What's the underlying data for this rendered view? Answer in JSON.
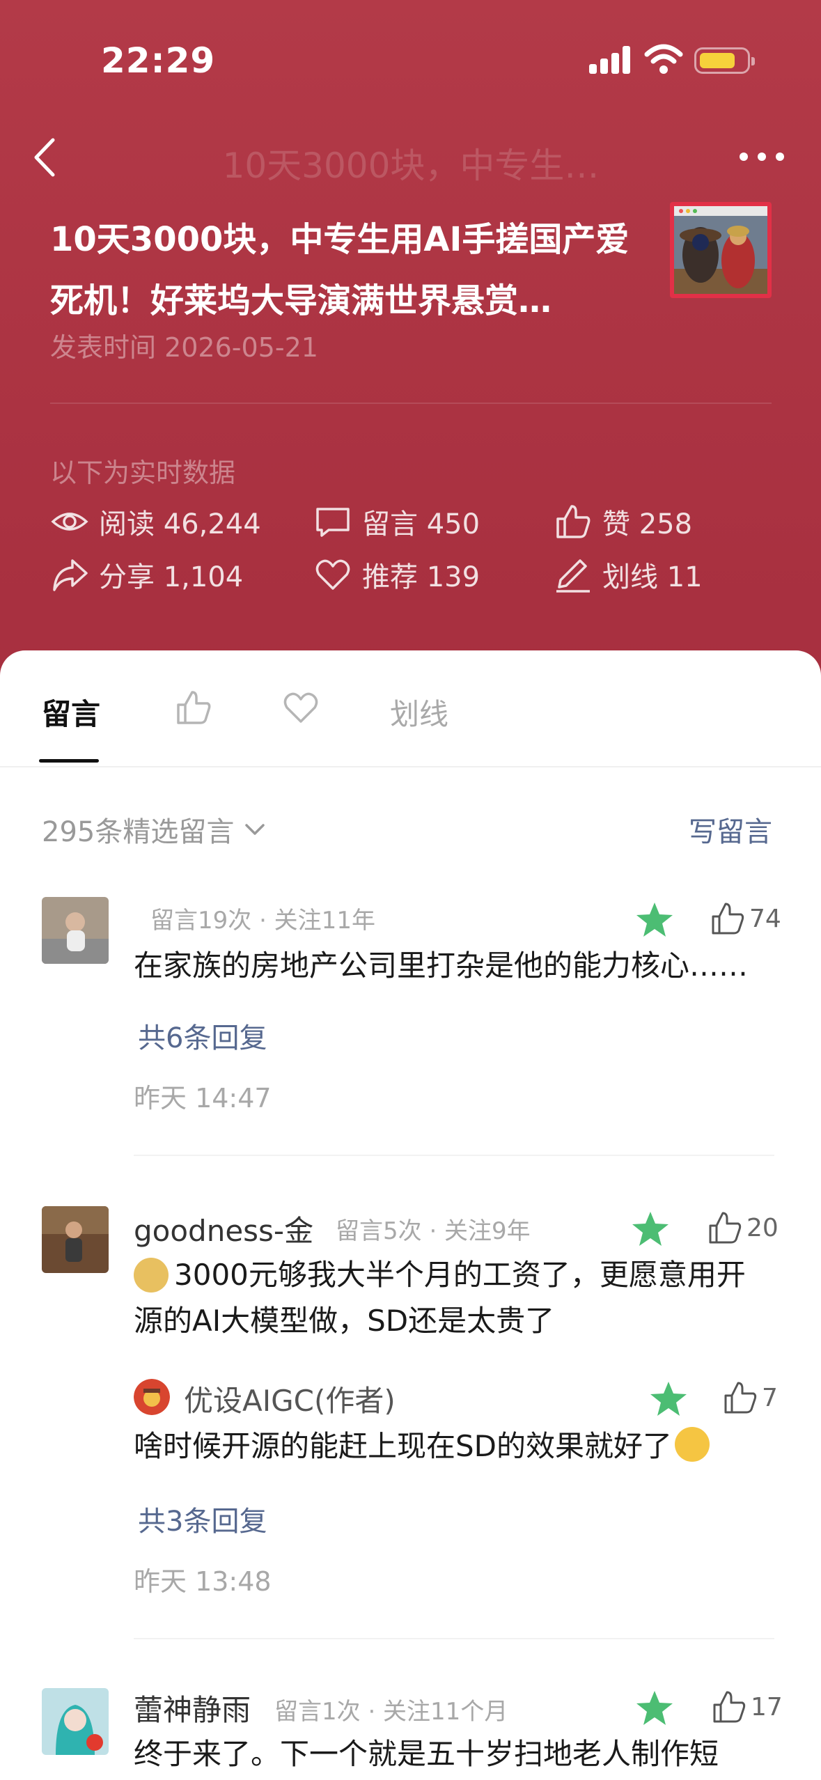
{
  "status_bar": {
    "time": "22:29"
  },
  "nav": {
    "title": "10天3000块，中专生…"
  },
  "article": {
    "title": "10天3000块，中专生用AI手搓国产爱死机！好莱坞大导演满世界悬赏…",
    "publish_time": "发表时间 2026-05-21",
    "realtime_label": "以下为实时数据"
  },
  "stats": {
    "reads": "阅读 46,244",
    "comments": "留言 450",
    "likes": "赞 258",
    "shares": "分享 1,104",
    "recommends": "推荐 139",
    "highlights": "划线 11"
  },
  "tabs": {
    "comments": "留言",
    "highlights": "划线"
  },
  "comment_header": {
    "count": "295条精选留言",
    "write": "写留言"
  },
  "comments": [
    {
      "meta": "留言19次 · 关注11年",
      "likes": "74",
      "text": "在家族的房地产公司里打杂是他的能力核心……",
      "replies_link": "共6条回复",
      "time": "昨天 14:47"
    },
    {
      "name": "goodness-金",
      "meta": "留言5次 · 关注9年",
      "likes": "20",
      "text": "3000元够我大半个月的工资了，更愿意用开源的AI大模型做，SD还是太贵了",
      "author_reply": {
        "name": "优设AIGC(作者)",
        "likes": "7",
        "text": "啥时候开源的能赶上现在SD的效果就好了"
      },
      "replies_link": "共3条回复",
      "time": "昨天 13:48"
    },
    {
      "name": "蕾神静雨",
      "meta": "留言1次 · 关注11个月",
      "likes": "17",
      "text": "终于来了。下一个就是五十岁扫地老人制作短"
    }
  ],
  "colors": {
    "header_bg": "#b03746",
    "link": "#56688f",
    "star": "#4cbd73"
  }
}
